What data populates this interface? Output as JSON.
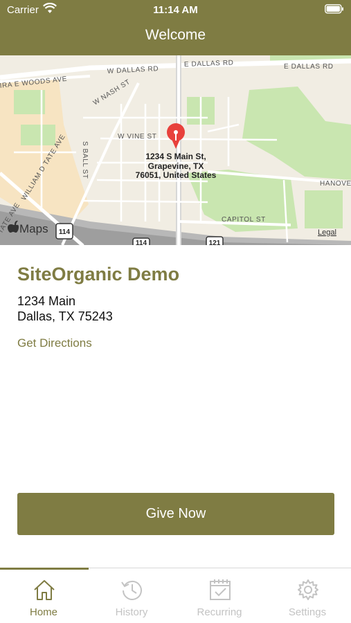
{
  "status_bar": {
    "carrier": "Carrier",
    "time": "11:14 AM"
  },
  "nav": {
    "title": "Welcome"
  },
  "map": {
    "streets": {
      "w_dallas_rd": "W DALLAS RD",
      "e_dallas_rd_1": "E DALLAS RD",
      "e_dallas_rd_2": "E DALLAS RD",
      "ira_e_woods_ave": "IRA E WOODS AVE",
      "w_nash_st": "W NASH ST",
      "w_vine_st": "W VINE ST",
      "s_ball_st": "S BALL ST",
      "william_d_tate_ave": "WILLIAM D TATE AVE",
      "tate_ave_fragment": "TATE AVE",
      "hanover": "HANOVE",
      "capitol_st": "CAPITOL ST"
    },
    "pin_address": {
      "line1": "1234 S Main St,",
      "line2": "Grapevine, TX",
      "line3": "76051, United States"
    },
    "highway_shields": [
      "114",
      "114",
      "121"
    ],
    "brand": "Maps",
    "legal": "Legal"
  },
  "organization": {
    "name": "SiteOrganic Demo",
    "address_line1": "1234 Main",
    "address_line2": "Dallas, TX 75243",
    "directions_label": "Get Directions"
  },
  "give_button": {
    "label": "Give Now"
  },
  "tabs": [
    {
      "label": "Home",
      "icon": "home-icon",
      "active": true
    },
    {
      "label": "History",
      "icon": "history-icon",
      "active": false
    },
    {
      "label": "Recurring",
      "icon": "calendar-check-icon",
      "active": false
    },
    {
      "label": "Settings",
      "icon": "gear-icon",
      "active": false
    }
  ],
  "colors": {
    "brand": "#7f7c43",
    "map_land": "#f1ede3",
    "map_park": "#c9e6b0",
    "map_sand": "#f7e4c2",
    "pin": "#e8413c",
    "inactive_tab": "#c3c3c3"
  }
}
